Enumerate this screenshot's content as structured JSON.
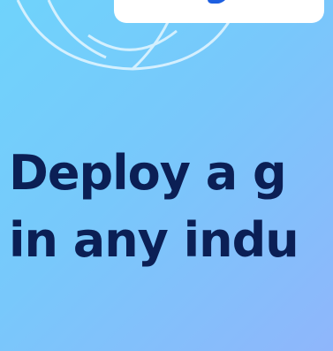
{
  "hero": {
    "headline_line1": "Deploy a g",
    "headline_line2": "in any indu"
  },
  "colors": {
    "background_start": "#6fd3fb",
    "background_end": "#8fb6fb",
    "headline": "#0b1f55",
    "card": "#ffffff",
    "card_accent": "#1d5fe0",
    "globe_lines": "#dff4ff"
  },
  "icons": {
    "globe": "globe-outline-icon"
  }
}
